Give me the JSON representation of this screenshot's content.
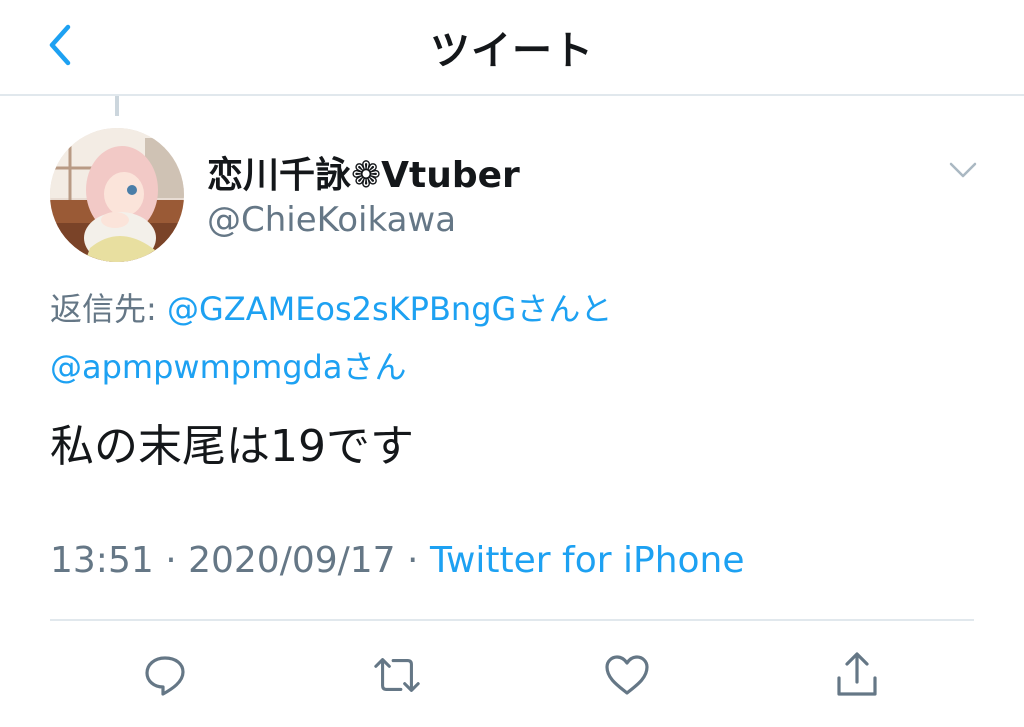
{
  "nav": {
    "title": "ツイート",
    "back_icon": "chevron-left-icon"
  },
  "tweet": {
    "display_name": "恋川千詠❁Vtuber",
    "handle": "@ChieKoikawa",
    "replying_to_label": "返信先:",
    "mention_1": "@GZAMEos2sKPBngG",
    "mention_1_suffix": "さんと",
    "mention_2": "@apmpwmpmgda",
    "mention_2_suffix": "さん",
    "text": "私の末尾は19です",
    "time": "13:51",
    "separator": " · ",
    "date": "2020/09/17",
    "source": "Twitter for iPhone"
  },
  "actions": [
    {
      "name": "reply",
      "icon": "reply-icon"
    },
    {
      "name": "retweet",
      "icon": "retweet-icon"
    },
    {
      "name": "like",
      "icon": "heart-icon"
    },
    {
      "name": "share",
      "icon": "share-icon"
    }
  ],
  "colors": {
    "accent": "#1da1f2",
    "secondary_text": "#657786",
    "primary_text": "#14171a",
    "divider": "#e1e8ed"
  }
}
